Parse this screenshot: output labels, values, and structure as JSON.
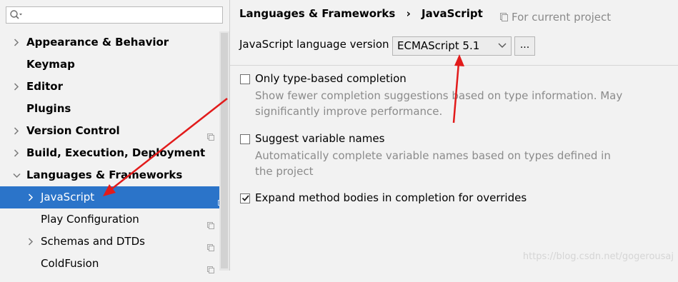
{
  "search": {
    "placeholder": ""
  },
  "tree": [
    {
      "label": "Appearance & Behavior",
      "bold": true,
      "arrow": "right",
      "indent": 0,
      "project": false
    },
    {
      "label": "Keymap",
      "bold": true,
      "arrow": "",
      "indent": 0,
      "project": false
    },
    {
      "label": "Editor",
      "bold": true,
      "arrow": "right",
      "indent": 0,
      "project": false
    },
    {
      "label": "Plugins",
      "bold": true,
      "arrow": "",
      "indent": 0,
      "project": false
    },
    {
      "label": "Version Control",
      "bold": true,
      "arrow": "right",
      "indent": 0,
      "project": true
    },
    {
      "label": "Build, Execution, Deployment",
      "bold": true,
      "arrow": "right",
      "indent": 0,
      "project": false
    },
    {
      "label": "Languages & Frameworks",
      "bold": true,
      "arrow": "down",
      "indent": 0,
      "project": false
    },
    {
      "label": "JavaScript",
      "bold": false,
      "arrow": "right",
      "indent": 1,
      "project": true,
      "selected": true
    },
    {
      "label": "Play Configuration",
      "bold": false,
      "arrow": "",
      "indent": 1,
      "project": true
    },
    {
      "label": "Schemas and DTDs",
      "bold": false,
      "arrow": "right",
      "indent": 1,
      "project": true
    },
    {
      "label": "ColdFusion",
      "bold": false,
      "arrow": "",
      "indent": 1,
      "project": true
    }
  ],
  "breadcrumb": {
    "parent": "Languages & Frameworks",
    "separator": "›",
    "current": "JavaScript"
  },
  "for_project": "For current project",
  "language_version": {
    "label": "JavaScript language version",
    "value": "ECMAScript 5.1",
    "more": "..."
  },
  "options": [
    {
      "id": "opt1",
      "title": "Only type-based completion",
      "checked": false,
      "desc": "Show fewer completion suggestions based on type information. May significantly improve performance."
    },
    {
      "id": "opt2",
      "title": "Suggest variable names",
      "checked": false,
      "desc": "Automatically complete variable names based on types defined in the project"
    },
    {
      "id": "opt3",
      "title": "Expand method bodies in completion for overrides",
      "checked": true,
      "desc": ""
    }
  ],
  "watermark": "https://blog.csdn.net/gogerousaj",
  "colors": {
    "selection": "#2b74c9",
    "annotation_arrow": "#e21b1b"
  }
}
